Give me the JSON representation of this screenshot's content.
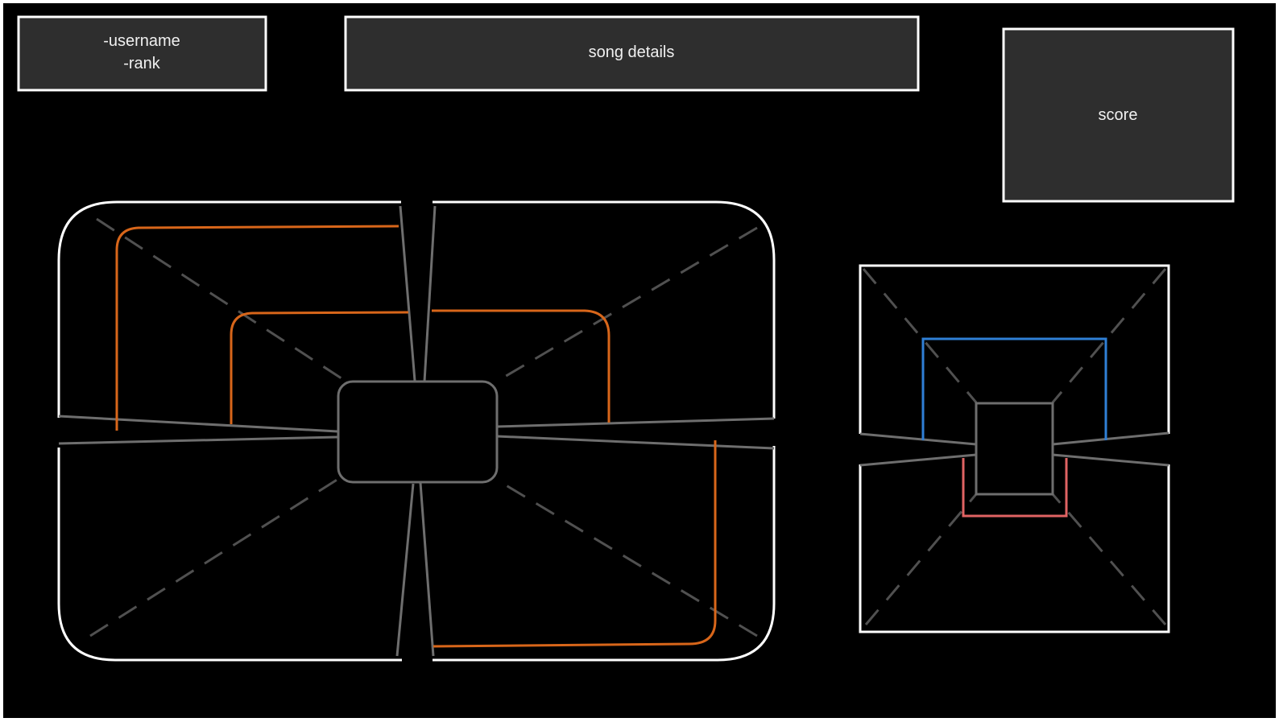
{
  "user_panel": {
    "line1": "-username",
    "line2": "-rank"
  },
  "song_panel": {
    "label": "song details"
  },
  "score_panel": {
    "label": "score"
  },
  "colors": {
    "background": "#000000",
    "panel_fill": "#2e2e2e",
    "outline": "#ffffff",
    "lane_gray": "#6e6e6e",
    "guide_dash": "#505050",
    "note_orange": "#d8661a",
    "note_blue": "#2f7fd6",
    "note_red": "#e06363"
  },
  "main_playfield": {
    "center_hub": "rounded-rectangle",
    "notes": [
      "orange-outer-top-left",
      "orange-inner-top-left",
      "orange-inner-top-right",
      "orange-outer-bottom-right"
    ]
  },
  "side_playfield": {
    "center_hub": "rectangle",
    "notes": [
      "blue-top",
      "red-bottom"
    ]
  }
}
